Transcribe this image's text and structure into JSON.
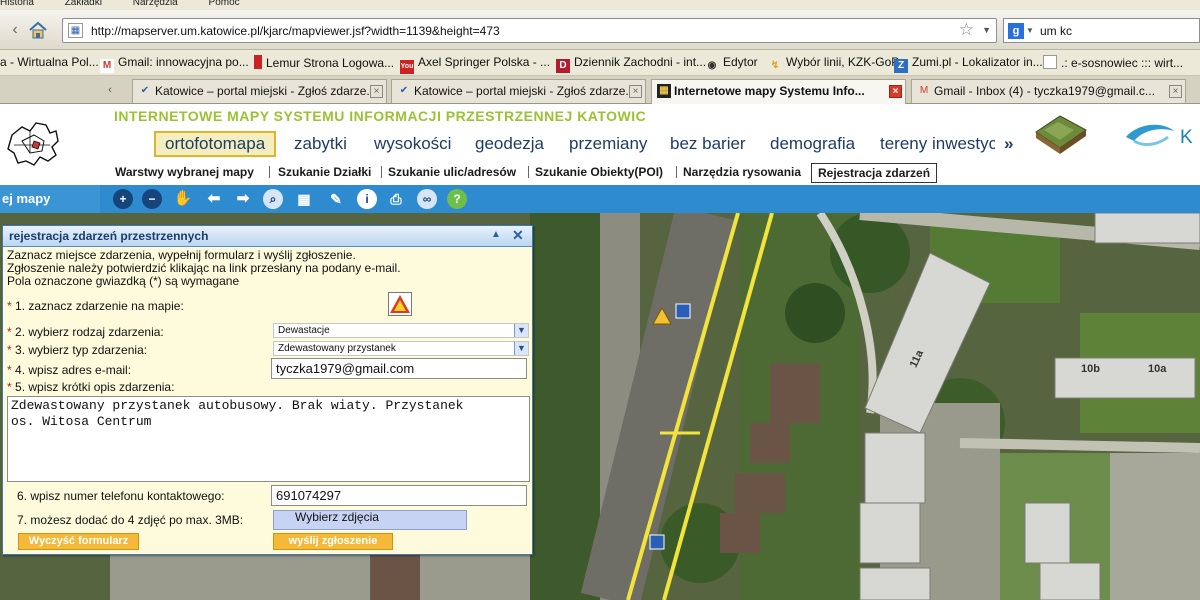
{
  "browser": {
    "menu": [
      "Historia",
      "Zakładki",
      "Narzędzia",
      "Pomoc"
    ],
    "url": "http://mapserver.um.katowice.pl/kjarc/mapviewer.jsf?width=1139&height=473",
    "search_query": "um kc",
    "bookmarks": [
      "a - Wirtualna Pol...",
      "Gmail: innowacyjna po...",
      "Lemur Strona Logowa...",
      "Axel Springer Polska - ...",
      "Dziennik Zachodni - int...",
      "Edytor",
      "Wybór linii, KZK-GoP",
      "Zumi.pl - Lokalizator in...",
      ".: e-sosnowiec ::: wirt..."
    ],
    "tabs": [
      {
        "label": "Katowice – portal miejski - Zgłoś zdarze...",
        "active": false
      },
      {
        "label": "Katowice – portal miejski - Zgłoś zdarze...",
        "active": false
      },
      {
        "label": "Internetowe mapy Systemu Info...",
        "active": true
      },
      {
        "label": "Gmail - Inbox (4) - tyczka1979@gmail.c...",
        "active": false
      }
    ]
  },
  "app": {
    "title": "INTERNETOWE MAPY SYSTEMU INFORMACJI PRZESTRZENNEJ KATOWIC",
    "layer_tabs": [
      "ortofotomapa",
      "zabytki",
      "wysokości",
      "geodezja",
      "przemiany",
      "bez barier",
      "demografia",
      "tereny inwestyc"
    ],
    "layer_more": "»",
    "logo_text": "K",
    "tool_tabs": [
      "Warstwy wybranej mapy",
      "Szukanie Działki",
      "Szukanie ulic/adresów",
      "Szukanie Obiekty(POI)",
      "Narzędzia rysowania",
      "Rejestracja zdarzeń"
    ],
    "side_label": "ej mapy"
  },
  "panel": {
    "title": "rejestracja zdarzeń przestrzennych",
    "intro": [
      "Zaznacz miejsce zdarzenia, wypełnij formularz i wyślij zgłoszenie.",
      "Zgłoszenie należy potwierdzić klikając na link przesłany na podany e-mail.",
      "Pola oznaczone gwiazdką (*) są wymagane"
    ],
    "step1": "1. zaznacz zdarzenie na mapie:",
    "step2": "2. wybierz rodzaj zdarzenia:",
    "step2_value": "Dewastacje",
    "step3": "3. wybierz typ zdarzenia:",
    "step3_value": "Zdewastowany przystanek",
    "step4": "4. wpisz adres e-mail:",
    "step4_value": "tyczka1979@gmail.com",
    "step5": "5. wpisz krótki opis zdarzenia:",
    "step5_value": "Zdewastowany przystanek autobusowy. Brak wiaty. Przystanek\nos. Witosa Centrum",
    "step6": "6. wpisz numer telefonu kontaktowego:",
    "step6_value": "691074297",
    "step7": "7. możesz dodać do 4 zdjęć po max. 3MB:",
    "photo_button": "Wybierz zdjęcia",
    "clear_button": "Wyczyść formularz",
    "send_button": "wyślij zgłoszenie",
    "required_mark": "*"
  },
  "map": {
    "building_labels": [
      "10b",
      "10a",
      "11a"
    ]
  },
  "colors": {
    "accent_green": "#9ac233",
    "toolbar_blue": "#2f8bd0",
    "panel_bg": "#fdfbdc",
    "button_orange": "#f5b93a"
  }
}
